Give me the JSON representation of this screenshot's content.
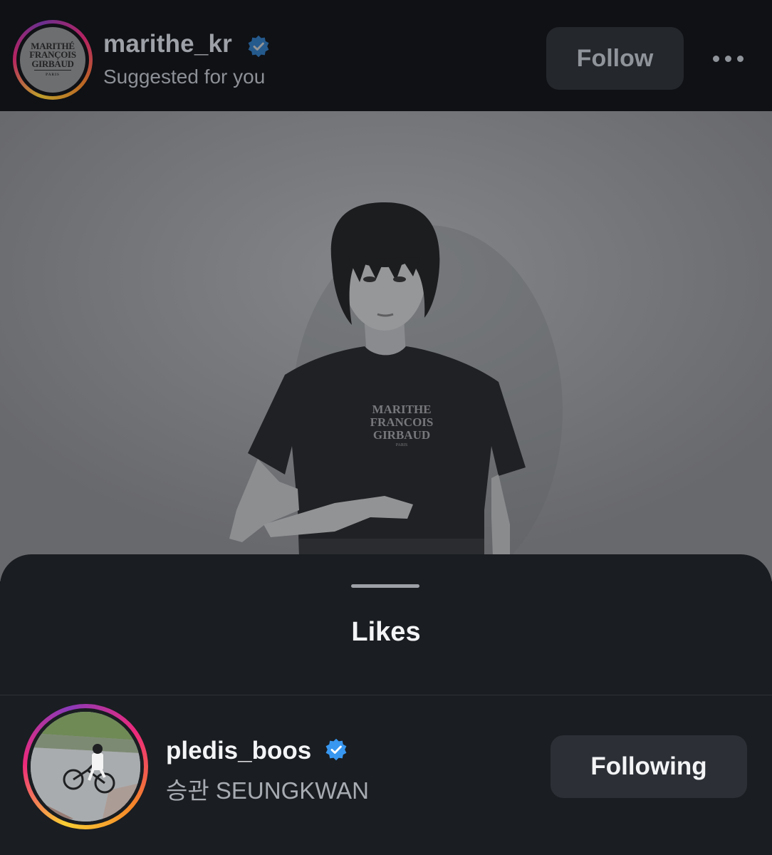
{
  "post": {
    "username": "marithe_kr",
    "subtitle": "Suggested for you",
    "follow_label": "Follow",
    "verified": true,
    "avatar_logo": {
      "line1": "MARITHÉ",
      "line2": "FRANÇOIS",
      "line3": "GIRBAUD",
      "line4": "PARIS"
    }
  },
  "sheet": {
    "title": "Likes",
    "likes": [
      {
        "username": "pledis_boos",
        "display_name": "승관 SEUNGKWAN",
        "verified": true,
        "button_label": "Following"
      }
    ]
  },
  "colors": {
    "verified_blue": "#3897f0",
    "story_ring_start": "#f9ce34",
    "story_ring_mid": "#ee2a7b",
    "story_ring_end": "#8a3ab9"
  }
}
